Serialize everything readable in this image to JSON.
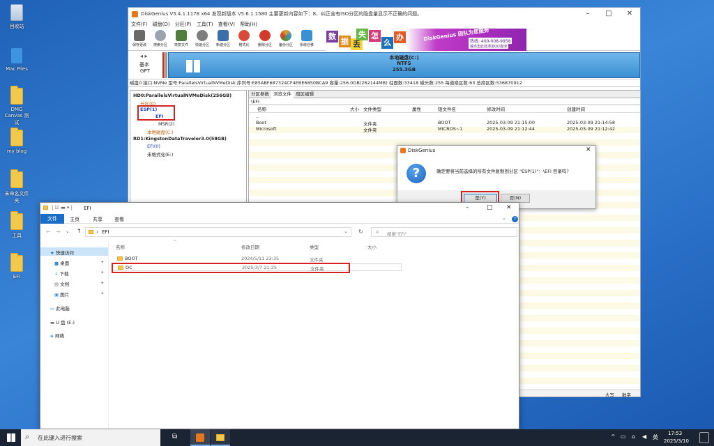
{
  "desktop_icons": [
    {
      "label": "回收站",
      "kind": "recycle"
    },
    {
      "label": "Mac Files",
      "kind": "macfiles"
    },
    {
      "label": "DMG Canvas 测试",
      "kind": "folder"
    },
    {
      "label": "my blog",
      "kind": "folder"
    },
    {
      "label": "未命名文件夹",
      "kind": "folder"
    },
    {
      "label": "工具",
      "kind": "folder"
    },
    {
      "label": "EFI",
      "kind": "folder"
    }
  ],
  "diskgenius": {
    "title": "DiskGenius V5.4.1.1178 x64   发现新版本 V5.6.1.1580   主要更新内容如下：8、纠正含有ISO分区的隐盘量显示不正确的问题。",
    "menu": [
      "文件(F)",
      "磁盘(D)",
      "分区(P)",
      "工具(T)",
      "查看(V)",
      "帮助(H)"
    ],
    "toolbar": [
      {
        "label": "保存更改",
        "color": "#6a6a6a"
      },
      {
        "label": "搜索分区",
        "color": "#9aa2ad"
      },
      {
        "label": "恢复文件",
        "color": "#4f7f3a"
      },
      {
        "label": "快速分区",
        "color": "#7d7d7d"
      },
      {
        "label": "新建分区",
        "color": "#3a6fa8"
      },
      {
        "label": "格式化",
        "color": "#d64b3a"
      },
      {
        "label": "删除分区",
        "color": "#d23a2a"
      },
      {
        "label": "备份分区",
        "color": "#e0a020"
      },
      {
        "label": "系统迁移",
        "color": "#3c8fd0"
      }
    ],
    "banner": {
      "chars": [
        "数",
        "据",
        "丢",
        "失",
        "怎",
        "么",
        "办"
      ],
      "slogan": "DiskGenius 团队为您服务",
      "phone": "热线: 400-008-9958",
      "qq": "或点击此处添加QQ咨询"
    },
    "disk_label": {
      "line1": "基本",
      "line2": "GPT"
    },
    "partition": {
      "name": "本地磁盘(C:)",
      "fs": "NTFS",
      "size": "255.3GB"
    },
    "diskinfo": "磁盘0 接口:NVMe  型号:ParallelsVirtualNVMeDisk  序列号:E85ABF687324CF4EBE6850BCA9  容量:256.0GB(262144MB)  柱面数:33418  磁头数:255  每道扇区数:63  总扇区数:536870912",
    "tree": [
      "HD0:ParallelsVirtualNVMeDisk(256GB)",
      "分区(0)",
      "ESP(1)",
      "EFI",
      "MSR(2)",
      "本地磁盘(C:)",
      "RD1:KingstonDataTraveler3.0(58GB)",
      "EFI(0)",
      "未格式化(E:)"
    ],
    "tabs": [
      "分区参数",
      "浏览文件",
      "扇区编辑"
    ],
    "path": "\\EFI",
    "columns": [
      "名称",
      "大小",
      "文件类型",
      "属性",
      "短文件名",
      "修改时间",
      "创建时间"
    ],
    "files": [
      {
        "name": "..",
        "size": "",
        "type": "",
        "attr": "",
        "short": "",
        "mtime": "",
        "ctime": ""
      },
      {
        "name": "Boot",
        "size": "",
        "type": "文件夹",
        "attr": "",
        "short": "BOOT",
        "mtime": "2025-03-09 21:15:00",
        "ctime": "2025-03-09 21:14:58"
      },
      {
        "name": "Microsoft",
        "size": "",
        "type": "文件夹",
        "attr": "",
        "short": "MICROS~1",
        "mtime": "2025-03-09 21:12:44",
        "ctime": "2025-03-09 21:12:42"
      }
    ],
    "status": [
      "大写",
      "数字"
    ]
  },
  "dialog": {
    "title": "DiskGenius",
    "message": "确定要将当前选择的所有文件复制到分区 \"ESP(1)\"：\\EFI 目录吗?",
    "yes": "是(Y)",
    "no": "否(N)"
  },
  "explorer": {
    "title": "EFI",
    "ribbon": [
      "文件",
      "主页",
      "共享",
      "查看"
    ],
    "address": "EFI",
    "search_placeholder": "搜索\"EFI\"",
    "nav": [
      "快速访问",
      "桌面",
      "下载",
      "文档",
      "图片",
      "此电脑",
      "U 盘 (E:)",
      "网络"
    ],
    "columns": [
      "名称",
      "修改日期",
      "类型",
      "大小"
    ],
    "rows": [
      {
        "name": "BOOT",
        "date": "2024/5/11 23:35",
        "type": "文件夹",
        "size": ""
      },
      {
        "name": "OC",
        "date": "2025/3/7 21:25",
        "type": "文件夹",
        "size": ""
      }
    ]
  },
  "taskbar": {
    "search": "在此键入进行搜索",
    "time": "17:53",
    "date": "2025/3/10",
    "lang": "英"
  }
}
